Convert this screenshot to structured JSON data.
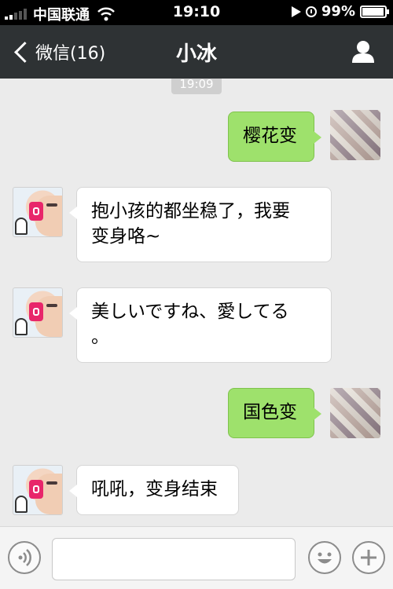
{
  "status_bar": {
    "carrier": "中国联通",
    "time": "19:10",
    "battery": "99%",
    "icons": [
      "signal-icon",
      "wifi-icon",
      "play-icon",
      "clock-icon",
      "battery-icon"
    ]
  },
  "nav": {
    "back_label": "微信(16)",
    "title": "小冰",
    "icons": [
      "chevron-left-icon",
      "profile-icon"
    ]
  },
  "chat": {
    "timestamp": "19:09",
    "messages": [
      {
        "sender": "me",
        "text": "樱花变"
      },
      {
        "sender": "bot",
        "text_lines": [
          "抱小孩的都坐稳了，我要",
          "变身咯~"
        ]
      },
      {
        "sender": "bot",
        "text_lines": [
          "美しいですね、愛してる",
          "。"
        ]
      },
      {
        "sender": "me",
        "text": "国色变"
      },
      {
        "sender": "bot",
        "text": "吼吼，变身结束"
      }
    ]
  },
  "input_bar": {
    "value": "",
    "icons": [
      "voice-icon",
      "emoji-icon",
      "plus-icon"
    ]
  },
  "colors": {
    "nav_background": "#2e3234",
    "chat_background": "#ebebeb",
    "my_bubble": "#9ee16c",
    "bot_bubble": "#ffffff"
  }
}
